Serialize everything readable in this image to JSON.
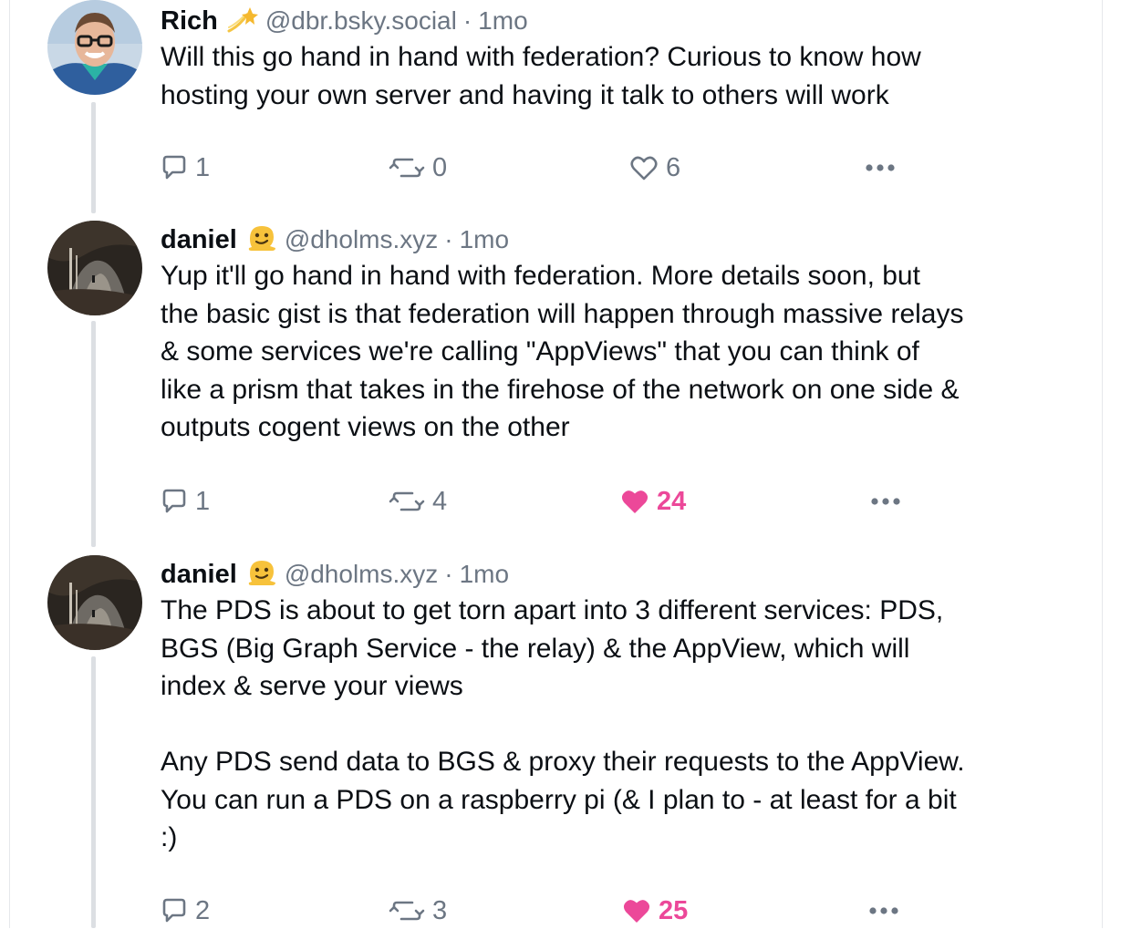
{
  "posts": [
    {
      "author": {
        "name": "Rich",
        "badge_emoji": "shooting-star-emoji",
        "handle": "@dbr.bsky.social"
      },
      "time": "1mo",
      "text": "Will this go hand in hand with federation? Curious to know how\nhosting your own server and having it talk to others will work",
      "counts": {
        "replies": "1",
        "reposts": "0",
        "likes": "6"
      },
      "liked": false
    },
    {
      "author": {
        "name": "daniel",
        "badge_emoji": "melting-face-emoji",
        "handle": "@dholms.xyz"
      },
      "time": "1mo",
      "text": "Yup it'll go hand in hand with federation. More details soon, but\nthe basic gist is that federation will happen through massive relays\n& some services we're calling \"AppViews\" that you can think of\nlike a prism that takes in the firehose of the network on one side &\noutputs cogent views on the other",
      "counts": {
        "replies": "1",
        "reposts": "4",
        "likes": "24"
      },
      "liked": true
    },
    {
      "author": {
        "name": "daniel",
        "badge_emoji": "melting-face-emoji",
        "handle": "@dholms.xyz"
      },
      "time": "1mo",
      "text": "The PDS is about to get torn apart into 3 different services: PDS,\nBGS (Big Graph Service - the relay) & the AppView, which will\nindex & serve your views\n\nAny PDS send data to BGS & proxy their requests to the AppView.\nYou can run a PDS on a raspberry pi (& I plan to - at least for a bit\n:)",
      "counts": {
        "replies": "2",
        "reposts": "3",
        "likes": "25"
      },
      "liked": true
    }
  ],
  "ui": {
    "separator": "·",
    "colors": {
      "text": "#0b0f14",
      "muted": "#6c7683",
      "like_active": "#ec4899",
      "thread_line": "#dcdfe3"
    }
  }
}
